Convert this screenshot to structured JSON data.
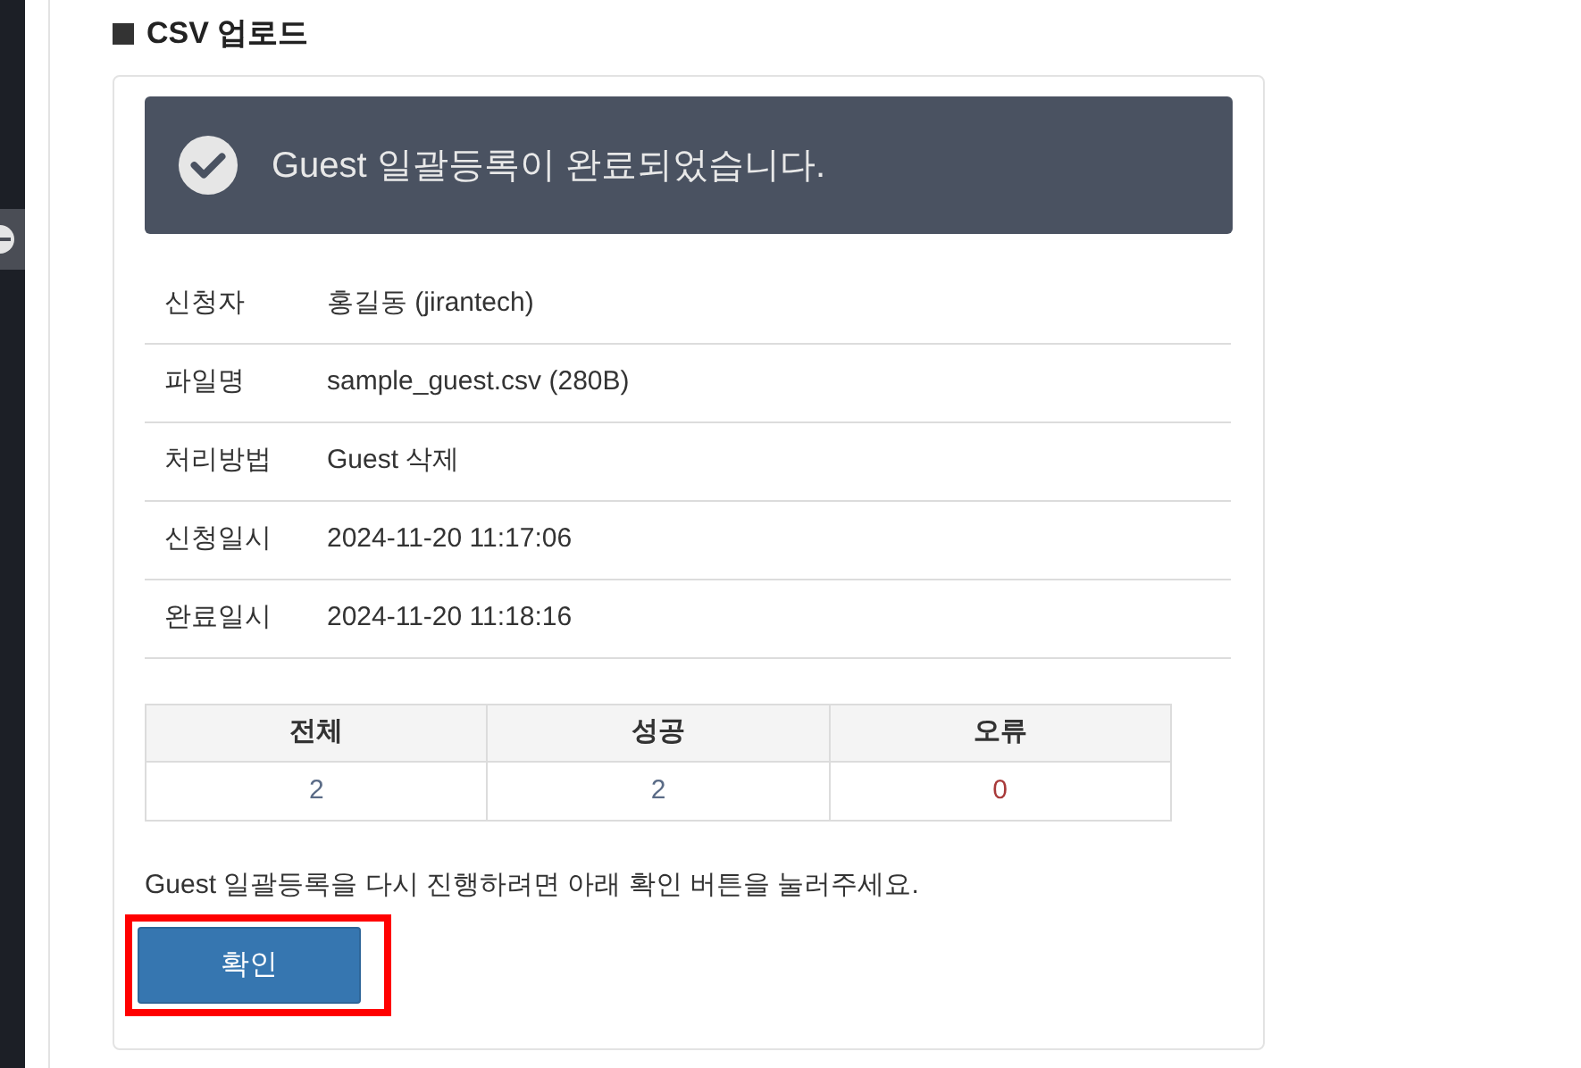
{
  "heading": "CSV 업로드",
  "alert": {
    "message": "Guest 일괄등록이 완료되었습니다."
  },
  "details": [
    {
      "label": "신청자",
      "value": "홍길동 (jirantech)"
    },
    {
      "label": "파일명",
      "value": "sample_guest.csv (280B)"
    },
    {
      "label": "처리방법",
      "value": "Guest 삭제"
    },
    {
      "label": "신청일시",
      "value": "2024-11-20 11:17:06"
    },
    {
      "label": "완료일시",
      "value": "2024-11-20 11:18:16"
    }
  ],
  "summary": {
    "columns": [
      "전체",
      "성공",
      "오류"
    ],
    "values": [
      {
        "text": "2",
        "color": "#5a6b86"
      },
      {
        "text": "2",
        "color": "#5a6b86"
      },
      {
        "text": "0",
        "color": "#a83a3a"
      }
    ]
  },
  "notice": "Guest 일괄등록을 다시 진행하려면 아래 확인 버튼을 눌러주세요.",
  "confirm_button": {
    "label": "확인",
    "highlighted": true
  }
}
